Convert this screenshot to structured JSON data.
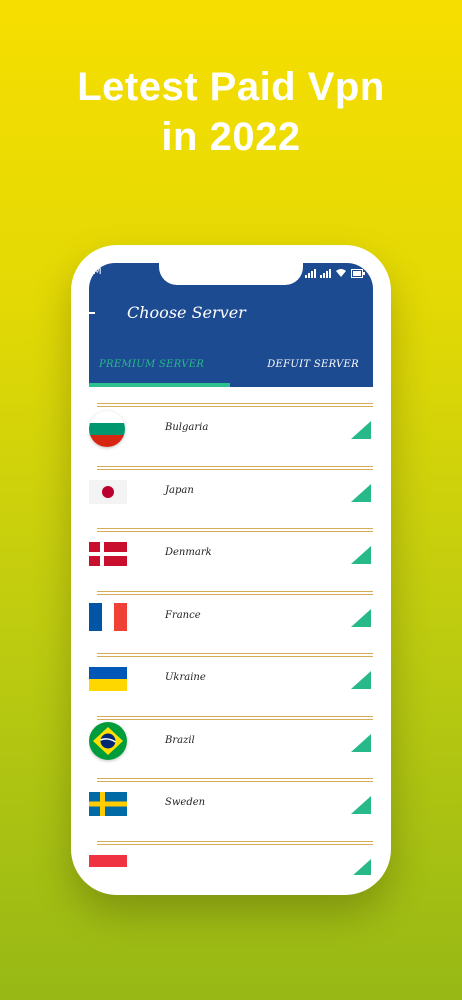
{
  "headline": {
    "line1": "Letest Paid Vpn",
    "line2": "in 2022"
  },
  "status_bar": {
    "left_text": "M"
  },
  "app": {
    "title": "Choose Server",
    "tabs": [
      {
        "label": "PREMIUM SERVER",
        "active": true
      },
      {
        "label": "DEFUIT SERVER",
        "active": false
      }
    ]
  },
  "servers": [
    {
      "country": "Bulgaria",
      "flag_icon": "bulgaria-flag-icon"
    },
    {
      "country": "Japan",
      "flag_icon": "japan-flag-icon"
    },
    {
      "country": "Denmark",
      "flag_icon": "denmark-flag-icon"
    },
    {
      "country": "France",
      "flag_icon": "france-flag-icon"
    },
    {
      "country": "Ukraine",
      "flag_icon": "ukraine-flag-icon"
    },
    {
      "country": "Brazil",
      "flag_icon": "brazil-flag-icon"
    },
    {
      "country": "Sweden",
      "flag_icon": "sweden-flag-icon"
    },
    {
      "country": "",
      "flag_icon": "singapore-flag-icon"
    }
  ],
  "colors": {
    "appbar": "#1d4b91",
    "accent": "#27b98a",
    "separator": "#d6ad56",
    "background_top": "#f6de00",
    "background_bottom": "#97b815"
  }
}
